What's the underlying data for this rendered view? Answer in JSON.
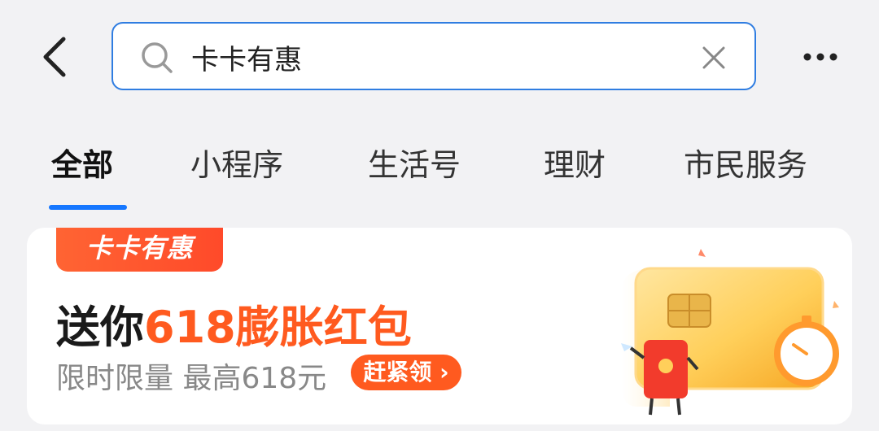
{
  "header": {
    "back_icon": "chevron-left-icon",
    "search": {
      "value": "卡卡有惠",
      "icon": "search-icon",
      "clear_icon": "close-icon"
    },
    "more_icon": "more-horizontal-icon",
    "accent_color": "#2f7de1"
  },
  "tabs": [
    {
      "label": "全部",
      "active": true
    },
    {
      "label": "小程序",
      "active": false
    },
    {
      "label": "生活号",
      "active": false
    },
    {
      "label": "理财",
      "active": false
    },
    {
      "label": "市民服务",
      "active": false
    }
  ],
  "promo": {
    "badge": "卡卡有惠",
    "title_prefix": "送你",
    "title_highlight": "618膨胀红包",
    "subtitle": "限时限量 最高618元",
    "cta": "赶紧领 ›",
    "highlight_color": "#ff5a1f",
    "illustration_icon": "gold-card-red-envelope-illustration"
  }
}
